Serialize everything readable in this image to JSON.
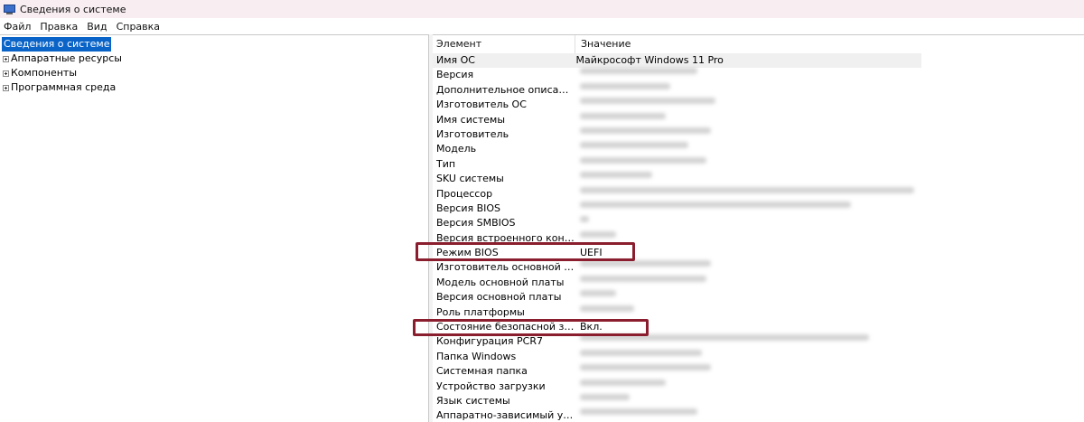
{
  "window": {
    "title": "Сведения о системе"
  },
  "menu": {
    "items": [
      "Файл",
      "Правка",
      "Вид",
      "Справка"
    ]
  },
  "tree": {
    "root": "Сведения о системе",
    "children": [
      "Аппаратные ресурсы",
      "Компоненты",
      "Программная среда"
    ]
  },
  "list": {
    "headers": {
      "element": "Элемент",
      "value": "Значение"
    },
    "rows": [
      {
        "element": "Имя ОС",
        "value": "Майкрософт Windows 11 Pro"
      },
      {
        "element": "Версия",
        "value": ""
      },
      {
        "element": "Дополнительное описание ОС",
        "value": ""
      },
      {
        "element": "Изготовитель ОС",
        "value": ""
      },
      {
        "element": "Имя системы",
        "value": ""
      },
      {
        "element": "Изготовитель",
        "value": ""
      },
      {
        "element": "Модель",
        "value": ""
      },
      {
        "element": "Тип",
        "value": ""
      },
      {
        "element": "SKU системы",
        "value": ""
      },
      {
        "element": "Процессор",
        "value": ""
      },
      {
        "element": "Версия BIOS",
        "value": ""
      },
      {
        "element": "Версия SMBIOS",
        "value": ""
      },
      {
        "element": "Версия встроенного контролл...",
        "value": ""
      },
      {
        "element": "Режим BIOS",
        "value": "UEFI"
      },
      {
        "element": "Изготовитель основной платы",
        "value": ""
      },
      {
        "element": "Модель основной платы",
        "value": ""
      },
      {
        "element": "Версия основной платы",
        "value": ""
      },
      {
        "element": "Роль платформы",
        "value": ""
      },
      {
        "element": "Состояние безопасной загруз...",
        "value": "Вкл."
      },
      {
        "element": "Конфигурация PCR7",
        "value": ""
      },
      {
        "element": "Папка Windows",
        "value": ""
      },
      {
        "element": "Системная папка",
        "value": ""
      },
      {
        "element": "Устройство загрузки",
        "value": ""
      },
      {
        "element": "Язык системы",
        "value": ""
      },
      {
        "element": "Аппаратно-зависимый урове...",
        "value": ""
      }
    ]
  },
  "colors": {
    "selection": "#0a64c8",
    "highlight_box": "#8b1e2e"
  }
}
